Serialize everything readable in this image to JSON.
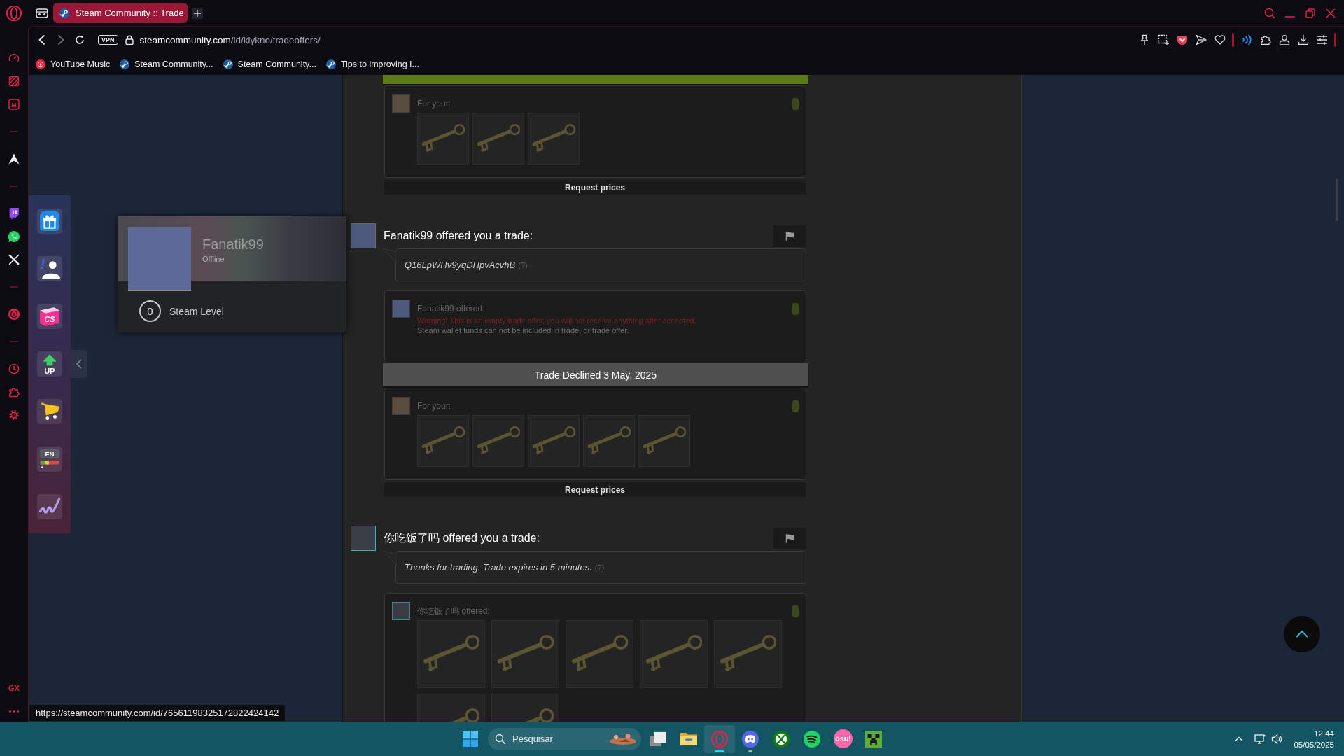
{
  "browser": {
    "tabs": [
      {
        "title": "Steam Community :: Trade",
        "selected": true
      }
    ],
    "toolbar": {
      "vpn": "VPN",
      "url_host": "steamcommunity.com",
      "url_path": "/id/kiykno/tradeoffers/"
    },
    "bookmarks": [
      {
        "kind": "youtube-music",
        "label": "YouTube Music"
      },
      {
        "kind": "steam",
        "label": "Steam Community..."
      },
      {
        "kind": "steam",
        "label": "Steam Community..."
      },
      {
        "kind": "steam",
        "label": "Tips to improving I..."
      }
    ]
  },
  "sidebar": {
    "items": [
      {
        "kind": "gauge"
      },
      {
        "kind": "stripes"
      },
      {
        "kind": "letter",
        "label": "M"
      },
      {
        "kind": "divider"
      },
      {
        "kind": "aria"
      },
      {
        "kind": "divider"
      },
      {
        "kind": "twitch"
      },
      {
        "kind": "whatsapp"
      },
      {
        "kind": "x"
      },
      {
        "kind": "divider"
      },
      {
        "kind": "music"
      },
      {
        "kind": "divider"
      },
      {
        "kind": "history"
      },
      {
        "kind": "extensions"
      },
      {
        "kind": "settings"
      }
    ],
    "footer_label": "GX"
  },
  "extension_panel": {
    "items": [
      {
        "kind": "gift"
      },
      {
        "kind": "person"
      },
      {
        "kind": "cs",
        "label": "CS"
      },
      {
        "kind": "up",
        "label": "UP"
      },
      {
        "kind": "cart"
      },
      {
        "kind": "fn",
        "label": "FN"
      },
      {
        "kind": "wave"
      }
    ]
  },
  "profile_card": {
    "name": "Fanatik99",
    "online": false,
    "status": "Offline",
    "level": "0",
    "level_label": "Steam Level"
  },
  "trade_offers": [
    {
      "sections": [
        {
          "kind": "banner",
          "accepted": true
        },
        {
          "kind": "yours",
          "label": "For your:",
          "items": [
            {
              "kind": "key"
            },
            {
              "kind": "key"
            },
            {
              "kind": "key"
            }
          ]
        }
      ],
      "request_prices": "Request prices"
    },
    {
      "partner": {
        "title": "Fanatik99 offered you a trade:",
        "online": false
      },
      "message": "Q16LpWHv9yqDHpvAcvhB",
      "help": "(?)",
      "sections": [
        {
          "kind": "theirs",
          "label": "Fanatik99 offered:",
          "warning": "Warning! This is an empty trade offer, you will not receive anything after accepted.",
          "note": "Steam wallet funds can not be included in trade, or trade offer."
        },
        {
          "kind": "banner",
          "accepted": false,
          "text": "Trade Declined 3 May, 2025"
        },
        {
          "kind": "yours",
          "label": "For your:",
          "items": [
            {
              "kind": "key"
            },
            {
              "kind": "key"
            },
            {
              "kind": "key"
            },
            {
              "kind": "key"
            },
            {
              "kind": "key"
            }
          ]
        }
      ],
      "request_prices": "Request prices"
    },
    {
      "partner": {
        "title": "你吃饭了吗 offered you a trade:",
        "online": true
      },
      "message": "Thanks for trading. Trade expires in 5 minutes.",
      "help": "(?)",
      "sections": [
        {
          "kind": "theirs",
          "label": "你吃饭了吗 offered:",
          "items": [
            {
              "kind": "key"
            },
            {
              "kind": "key"
            },
            {
              "kind": "key"
            },
            {
              "kind": "key"
            },
            {
              "kind": "key"
            },
            {
              "kind": "key"
            },
            {
              "kind": "key"
            }
          ]
        }
      ]
    }
  ],
  "status_bar": {
    "url": "https://steamcommunity.com/id/76561198325172822424142"
  },
  "taskbar": {
    "search_placeholder": "Pesquisar",
    "apps": [
      {
        "kind": "task-view",
        "selected": false,
        "running": false
      },
      {
        "kind": "explorer",
        "selected": false,
        "running": false
      },
      {
        "kind": "opera",
        "selected": true,
        "running": true
      },
      {
        "kind": "discord",
        "selected": false,
        "running": true
      },
      {
        "kind": "xbox",
        "selected": false,
        "running": false
      },
      {
        "kind": "spotify",
        "selected": false,
        "running": false
      },
      {
        "kind": "osu",
        "label": "osu!",
        "selected": false,
        "running": false
      },
      {
        "kind": "minecraft",
        "selected": false,
        "running": false
      }
    ],
    "time": "12:44",
    "date": "05/05/2025"
  }
}
